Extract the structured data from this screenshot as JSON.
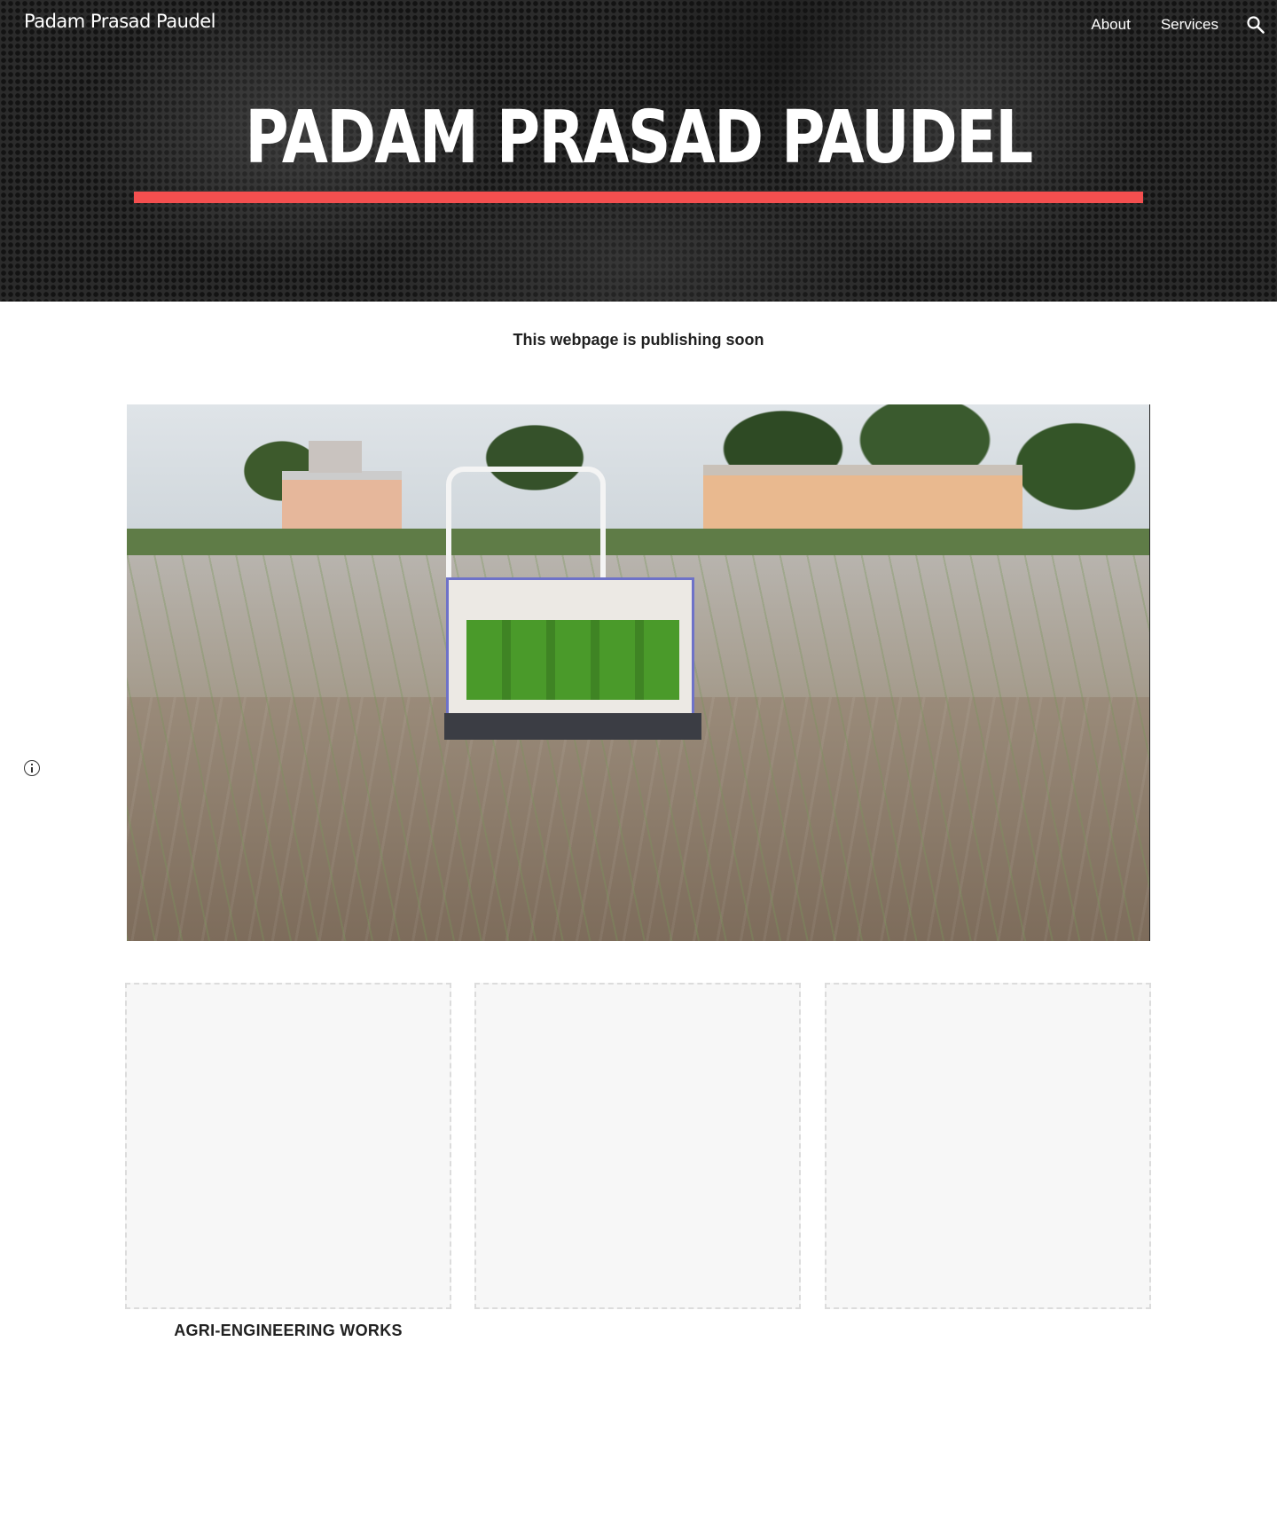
{
  "header": {
    "site_title": "Padam Prasad Paudel",
    "nav": [
      {
        "label": "ᅟᅟᅟᅟᅟᅟᅟᅟ"
      },
      {
        "label": "About"
      },
      {
        "label": "Services"
      }
    ],
    "search_icon": "search-icon"
  },
  "hero": {
    "heading": "PADAM PRASAD PAUDEL",
    "underline_color": "#f44f4f"
  },
  "main": {
    "notice": "This webpage is publishing soon",
    "cards": [
      {
        "caption": "AGRI-ENGINEERING WORKS"
      },
      {
        "caption": ""
      },
      {
        "caption": ""
      }
    ]
  },
  "footer": {
    "info_icon": "info-icon"
  }
}
